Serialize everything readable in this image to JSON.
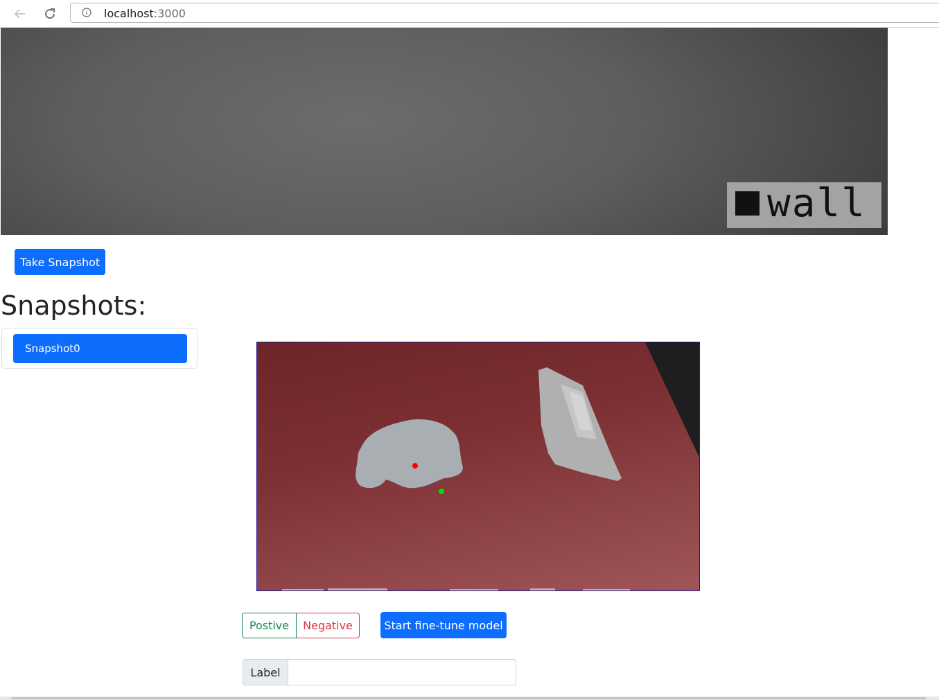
{
  "browser": {
    "url_host": "localhost",
    "url_port": ":3000"
  },
  "video": {
    "overlay_label": "wall"
  },
  "actions": {
    "take_snapshot_label": "Take Snapshot",
    "finetune_label": "Start fine-tune model"
  },
  "snapshots": {
    "heading": "Snapshots:",
    "items": [
      {
        "label": "Snapshot0"
      }
    ]
  },
  "point_type": {
    "positive_label": "Postive",
    "negative_label": "Negative",
    "positive_color": "#198754",
    "negative_color": "#dc3545"
  },
  "label_input": {
    "addon_label": "Label",
    "value": ""
  },
  "colors": {
    "primary": "#0d6efd",
    "mask": "#a9aeb2",
    "negative_point": "#ff0000",
    "positive_point": "#00e000"
  }
}
